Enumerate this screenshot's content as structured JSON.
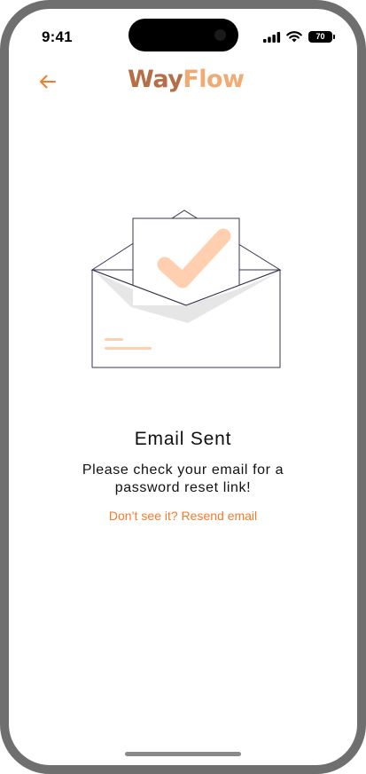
{
  "status_bar": {
    "time": "9:41",
    "battery_level": "70",
    "icons": [
      "cellular-signal-icon",
      "wifi-icon",
      "battery-icon"
    ]
  },
  "header": {
    "back_icon": "arrow-left-icon",
    "logo": {
      "part1": "Way",
      "part2": "Flow"
    }
  },
  "illustration": {
    "icon": "envelope-checkmark-illustration"
  },
  "content": {
    "title": "Email Sent",
    "message": "Please check your email for a password reset link!",
    "resend_link": "Don’t see it? Resend email"
  },
  "colors": {
    "accent": "#f27b2c",
    "logo_dark": "#b56e46",
    "logo_light": "#f2aa75",
    "check": "#ffcfb0",
    "frame": "#6f6f6f"
  }
}
